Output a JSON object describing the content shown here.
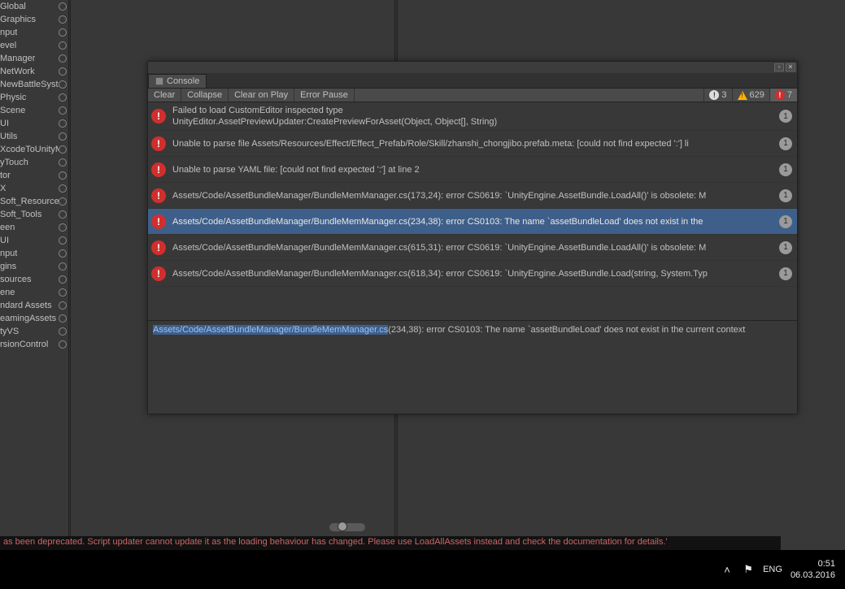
{
  "sidebar": {
    "items": [
      {
        "label": "Global"
      },
      {
        "label": "Graphics"
      },
      {
        "label": "nput"
      },
      {
        "label": "evel"
      },
      {
        "label": "Manager"
      },
      {
        "label": "NetWork"
      },
      {
        "label": "NewBattleSyste"
      },
      {
        "label": "Physic"
      },
      {
        "label": "Scene"
      },
      {
        "label": "UI"
      },
      {
        "label": "Utils"
      },
      {
        "label": "XcodeToUnityMs"
      },
      {
        "label": "yTouch"
      },
      {
        "label": "tor"
      },
      {
        "label": "X"
      },
      {
        "label": "Soft_Resources"
      },
      {
        "label": "Soft_Tools"
      },
      {
        "label": "een"
      },
      {
        "label": "UI"
      },
      {
        "label": "nput"
      },
      {
        "label": "gins"
      },
      {
        "label": "sources"
      },
      {
        "label": "ene"
      },
      {
        "label": "ndard Assets"
      },
      {
        "label": "eamingAssets"
      },
      {
        "label": "tyVS"
      },
      {
        "label": "rsionControl"
      }
    ]
  },
  "console": {
    "title": "Console",
    "toolbar": {
      "clear": "Clear",
      "collapse": "Collapse",
      "clear_on_play": "Clear on Play",
      "error_pause": "Error Pause"
    },
    "stats": {
      "info_count": "3",
      "warn_count": "629",
      "err_count": "7"
    },
    "entries": [
      {
        "text": "Failed to load CustomEditor inspected type\nUnityEditor.AssetPreviewUpdater:CreatePreviewForAsset(Object, Object[], String)",
        "count": "1",
        "selected": false
      },
      {
        "text": "Unable to parse file Assets/Resources/Effect/Effect_Prefab/Role/Skill/zhanshi_chongjibo.prefab.meta: [could not find expected ':'] li",
        "count": "1",
        "selected": false
      },
      {
        "text": "Unable to parse YAML file: [could not find expected ':'] at line 2",
        "count": "1",
        "selected": false
      },
      {
        "text": "Assets/Code/AssetBundleManager/BundleMemManager.cs(173,24): error CS0619: `UnityEngine.AssetBundle.LoadAll()' is obsolete: M",
        "count": "1",
        "selected": false
      },
      {
        "text": "Assets/Code/AssetBundleManager/BundleMemManager.cs(234,38): error CS0103: The name `assetBundleLoad' does not exist in the ",
        "count": "1",
        "selected": true
      },
      {
        "text": "Assets/Code/AssetBundleManager/BundleMemManager.cs(615,31): error CS0619: `UnityEngine.AssetBundle.LoadAll()' is obsolete: M",
        "count": "1",
        "selected": false
      },
      {
        "text": "Assets/Code/AssetBundleManager/BundleMemManager.cs(618,34): error CS0619: `UnityEngine.AssetBundle.Load(string, System.Typ",
        "count": "1",
        "selected": false
      }
    ],
    "detail": {
      "link": "Assets/Code/AssetBundleManager/BundleMemManager.cs",
      "rest": "(234,38): error CS0103: The name `assetBundleLoad' does not exist in the current context"
    }
  },
  "deprecated_bar": "as been deprecated. Script updater cannot update it as the loading behaviour has changed. Please use LoadAllAssets instead and check the documentation for details.'",
  "taskbar": {
    "lang": "ENG",
    "time": "0:51",
    "date": "06.03.2016"
  }
}
